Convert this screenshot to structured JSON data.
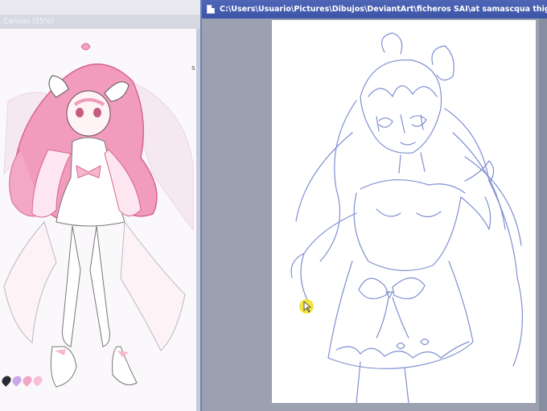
{
  "left_window": {
    "title": "Canvas (25%)",
    "side_label": "s",
    "swatch_colors": [
      "#2a2a33",
      "#c8a8e8",
      "#f1a5c8",
      "#f7bfd9"
    ]
  },
  "right_window": {
    "title": "C:\\Users\\Usuario\\Pictures\\Dibujos\\DeviantArt\\ficheros SAI\\at samascqua thighup doll.sai (*)"
  },
  "colors": {
    "title_bar": "#4f66b7",
    "sketch_line": "#7f8fd2",
    "hair_pink": "#f19bbd",
    "cursor": "#f2e21a"
  }
}
